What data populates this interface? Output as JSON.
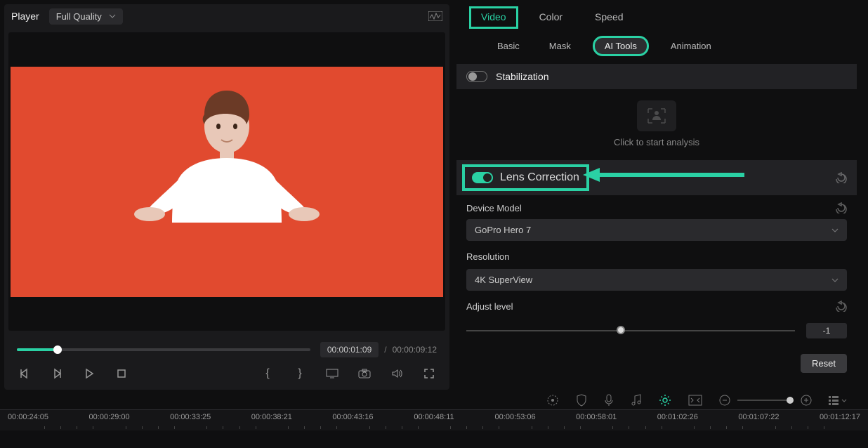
{
  "player": {
    "label": "Player",
    "quality": "Full Quality"
  },
  "time": {
    "current": "00:00:01:09",
    "total": "00:00:09:12"
  },
  "tabs_primary": {
    "video": "Video",
    "color": "Color",
    "speed": "Speed"
  },
  "tabs_secondary": {
    "basic": "Basic",
    "mask": "Mask",
    "ai_tools": "AI Tools",
    "animation": "Animation"
  },
  "stabilization": {
    "label": "Stabilization",
    "analysis_prompt": "Click to start analysis"
  },
  "lens": {
    "label": "Lens Correction",
    "device_model_label": "Device Model",
    "device_model_value": "GoPro Hero 7",
    "resolution_label": "Resolution",
    "resolution_value": "4K SuperView",
    "adjust_label": "Adjust level",
    "adjust_value": "-1"
  },
  "reset_label": "Reset",
  "timeline": {
    "ticks": [
      "00:00:24:05",
      "00:00:29:00",
      "00:00:33:25",
      "00:00:38:21",
      "00:00:43:16",
      "00:00:48:11",
      "00:00:53:06",
      "00:00:58:01",
      "00:01:02:26",
      "00:01:07:22",
      "00:01:12:17"
    ]
  },
  "scrub_percent": 14,
  "adjust_percent": 47,
  "colors": {
    "accent": "#2ad1a4",
    "video_bg": "#e14a2f"
  }
}
